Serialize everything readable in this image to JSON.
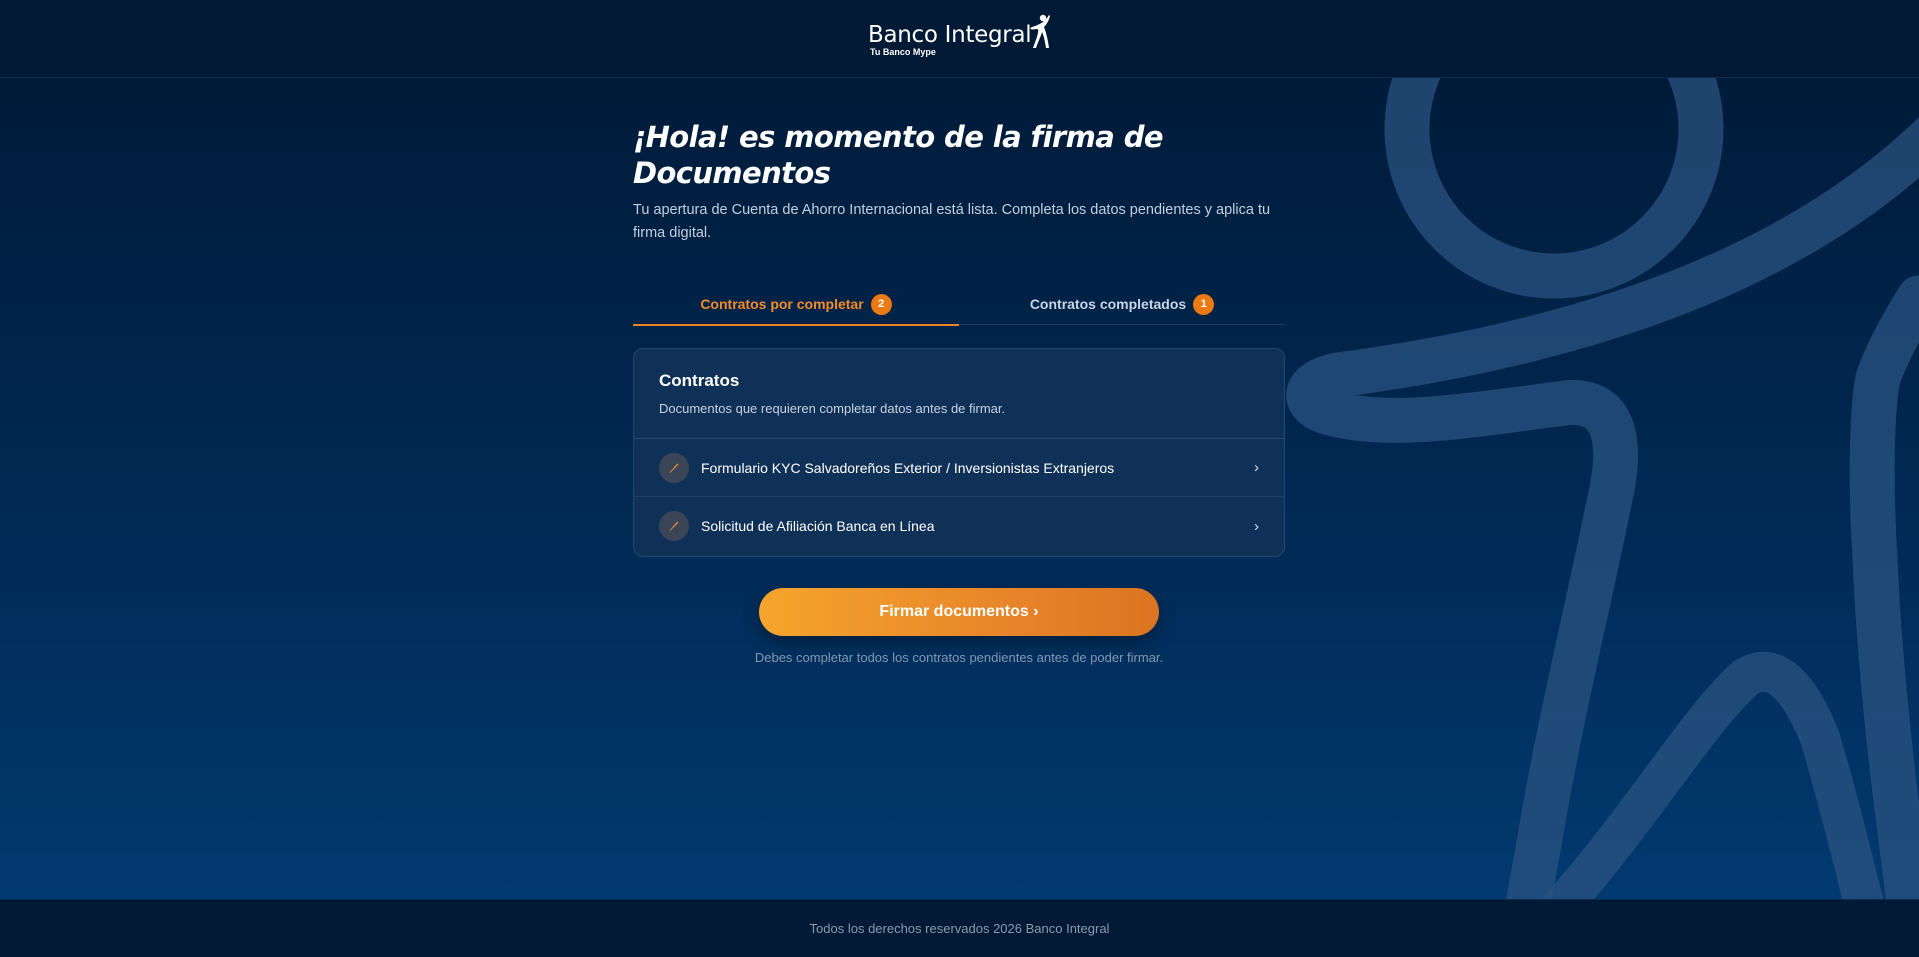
{
  "header": {
    "brand_name": "Banco Integral",
    "brand_tagline": "Tu Banco Mype"
  },
  "main": {
    "title": "¡Hola! es momento de la firma de Documentos",
    "subtitle": "Tu apertura de Cuenta de Ahorro Internacional está lista. Completa los datos pendientes y aplica tu firma digital.",
    "tabs": [
      {
        "label": "Contratos por completar",
        "count": "2",
        "active": true
      },
      {
        "label": "Contratos completados",
        "count": "1",
        "active": false
      }
    ],
    "card": {
      "title": "Contratos",
      "description": "Documentos que requieren completar datos antes de firmar.",
      "items": [
        {
          "label": "Formulario KYC Salvadoreños Exterior / Inversionistas Extranjeros",
          "icon": "pencil-icon"
        },
        {
          "label": "Solicitud de Afiliación Banca en Línea",
          "icon": "pencil-icon"
        }
      ]
    },
    "cta_label": "Firmar documentos ›",
    "cta_note": "Debes completar todos los contratos pendientes antes de poder firmar."
  },
  "footer": {
    "copyright": "Todos los derechos reservados 2026 Banco Integral"
  },
  "colors": {
    "accent": "#ee8326",
    "background_top": "#001b3a",
    "background_bottom": "#013a70",
    "card": "#0f3158"
  }
}
